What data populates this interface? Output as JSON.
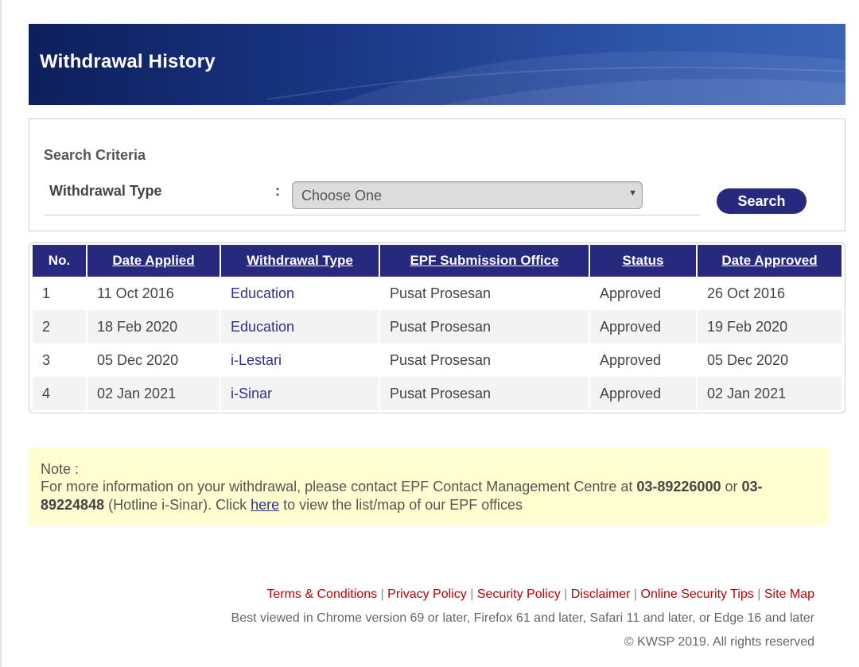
{
  "header": {
    "title": "Withdrawal History"
  },
  "search": {
    "section_label": "Search Criteria",
    "withdrawal_type_label": "Withdrawal Type",
    "colon": ":",
    "select_value": "Choose One",
    "button_label": "Search"
  },
  "table": {
    "headers": [
      "No.",
      "Date Applied",
      "Withdrawal Type",
      "EPF Submission Office",
      "Status",
      "Date Approved"
    ],
    "rows": [
      [
        "1",
        "11 Oct 2016",
        "Education",
        "Pusat Prosesan",
        "Approved",
        "26 Oct 2016"
      ],
      [
        "2",
        "18 Feb 2020",
        "Education",
        "Pusat Prosesan",
        "Approved",
        "19 Feb 2020"
      ],
      [
        "3",
        "05 Dec 2020",
        "i-Lestari",
        "Pusat Prosesan",
        "Approved",
        "05 Dec 2020"
      ],
      [
        "4",
        "02 Jan 2021",
        "i-Sinar",
        "Pusat Prosesan",
        "Approved",
        "02 Jan 2021"
      ]
    ]
  },
  "note": {
    "title": "Note :",
    "text_1": "For more information on your withdrawal, please contact EPF Contact Management Centre at ",
    "phone_1": "03-89226000",
    "text_2": " or ",
    "phone_2": "03-89224848",
    "text_3": " (Hotline i-Sinar). Click ",
    "link": "here",
    "text_4": " to view the list/map of our EPF offices"
  },
  "footer": {
    "links": [
      "Terms & Conditions",
      "Privacy Policy",
      "Security Policy",
      "Disclaimer",
      "Online Security Tips",
      "Site Map"
    ],
    "separator": "|",
    "browser_note": "Best viewed in Chrome version 69 or later, Firefox 61 and later, Safari 11 and later, or Edge 16 and later",
    "copyright": "© KWSP 2019. All rights reserved"
  },
  "colors": {
    "banner_dark": "#0d1f5c",
    "banner_light": "#3b64b6",
    "accent_navy": "#27297f",
    "link_blue": "#2e3192",
    "footer_link_red": "#c00000",
    "note_background": "#fefed0"
  },
  "icons": {
    "select_arrow": "chevron-down-icon"
  }
}
